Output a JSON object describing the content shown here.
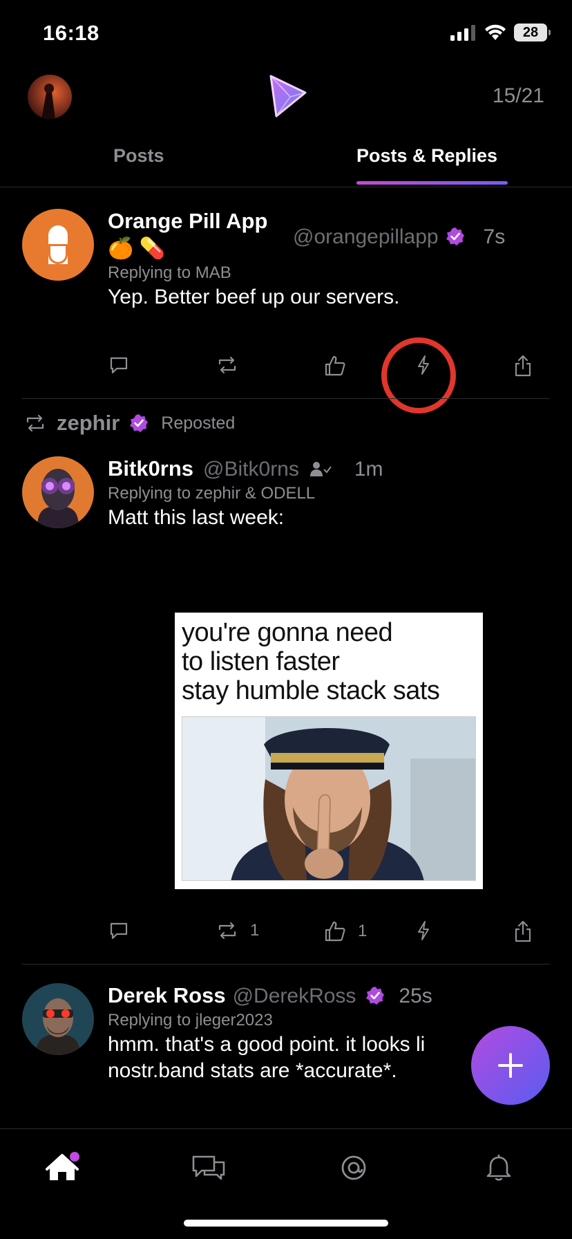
{
  "status_bar": {
    "time": "16:18",
    "battery": "28"
  },
  "header": {
    "counter": "15/21"
  },
  "tabs": [
    {
      "label": "Posts"
    },
    {
      "label": "Posts & Replies"
    }
  ],
  "posts": [
    {
      "display_name": "Orange Pill App",
      "emoji": "🍊 💊",
      "handle": "@orangepillapp",
      "time": "7s",
      "replying_to": "Replying to MAB",
      "content": "Yep. Better beef up our servers.",
      "reply_count": "",
      "repost_count": "",
      "like_count": ""
    },
    {
      "reposted_by": "zephir",
      "repost_label": "Reposted",
      "display_name": "Bitk0rns",
      "handle": "@Bitk0rns",
      "time": "1m",
      "replying_to": "Replying to zephir & ODELL",
      "content": "Matt this last week:",
      "meme_lines": [
        "you're gonna need",
        "to listen faster",
        "stay humble stack sats"
      ],
      "reply_count": "",
      "repost_count": "1",
      "like_count": "1"
    },
    {
      "display_name": "Derek Ross",
      "handle": "@DerekRoss",
      "time": "25s",
      "replying_to": "Replying to jleger2023",
      "content_line1": "hmm. that's a good point. it looks li",
      "content_line2": "nostr.band stats are *accurate*."
    }
  ],
  "colors": {
    "accent": "#a855f7",
    "verified": "#b04be0",
    "highlight_circle": "#e0362c",
    "orange_pill": "#e87a2f"
  },
  "icons": [
    "reply-icon",
    "repost-icon",
    "like-icon",
    "zap-icon",
    "share-icon",
    "home-icon",
    "messages-icon",
    "search-icon",
    "bell-icon",
    "plus-icon",
    "verified-icon"
  ]
}
